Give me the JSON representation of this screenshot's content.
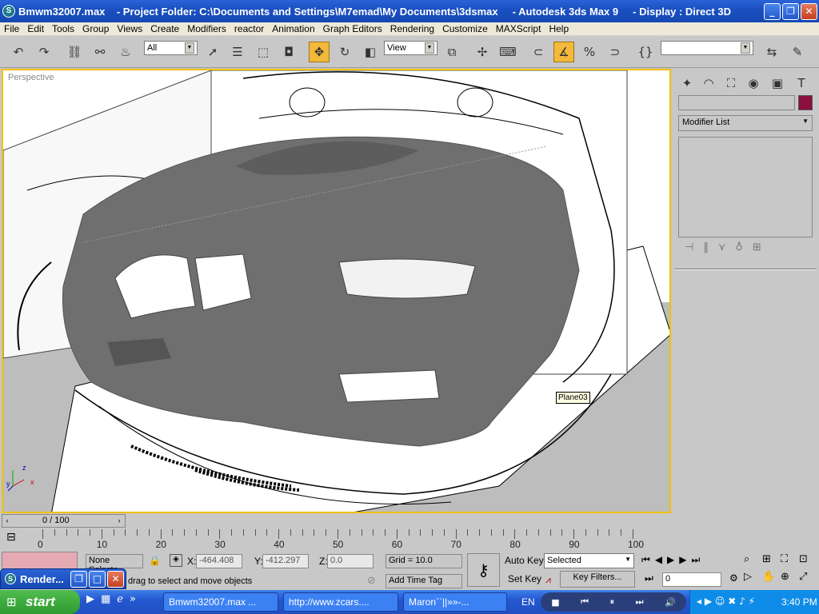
{
  "window": {
    "title": "Bmwm32007.max    - Project Folder: C:\\Documents and Settings\\M7emad\\My Documents\\3dsmax     - Autodesk 3ds Max 9     - Display : Direct 3D"
  },
  "menu": [
    "File",
    "Edit",
    "Tools",
    "Group",
    "Views",
    "Create",
    "Modifiers",
    "reactor",
    "Animation",
    "Graph Editors",
    "Rendering",
    "Customize",
    "MAXScript",
    "Help"
  ],
  "toolbar": {
    "selection_filter": "All",
    "ref_coord": "View",
    "named_selection": ""
  },
  "viewport": {
    "label": "Perspective",
    "tooltip": "Plane03",
    "axis_labels": {
      "z": "z",
      "y": "y",
      "x": "x"
    }
  },
  "command_panel": {
    "modifier_list": "Modifier List",
    "name_field": ""
  },
  "timeline": {
    "frame_display": "0 / 100",
    "ticks": [
      "0",
      "10",
      "20",
      "30",
      "40",
      "50",
      "60",
      "70",
      "80",
      "90",
      "100"
    ]
  },
  "status": {
    "selection": "None Selecte",
    "x_label": "X:",
    "x_value": "-464.408",
    "y_label": "Y:",
    "y_value": "-412.297",
    "z_label": "Z:",
    "z_value": "0.0",
    "grid": "Grid = 10.0",
    "prompt": "drag to select and move objects",
    "add_time_tag": "Add Time Tag",
    "auto_key": "Auto Key",
    "set_key": "Set Key",
    "key_mode": "Selected",
    "key_filters": "Key Filters...",
    "current_frame": "0"
  },
  "render_window": {
    "title": "Render..."
  },
  "taskbar": {
    "start": "start",
    "items": [
      "Bmwm32007.max ...",
      "http://www.zcars....",
      "Maron``||»»-..."
    ],
    "lang": "EN",
    "clock": "3:40 PM"
  }
}
